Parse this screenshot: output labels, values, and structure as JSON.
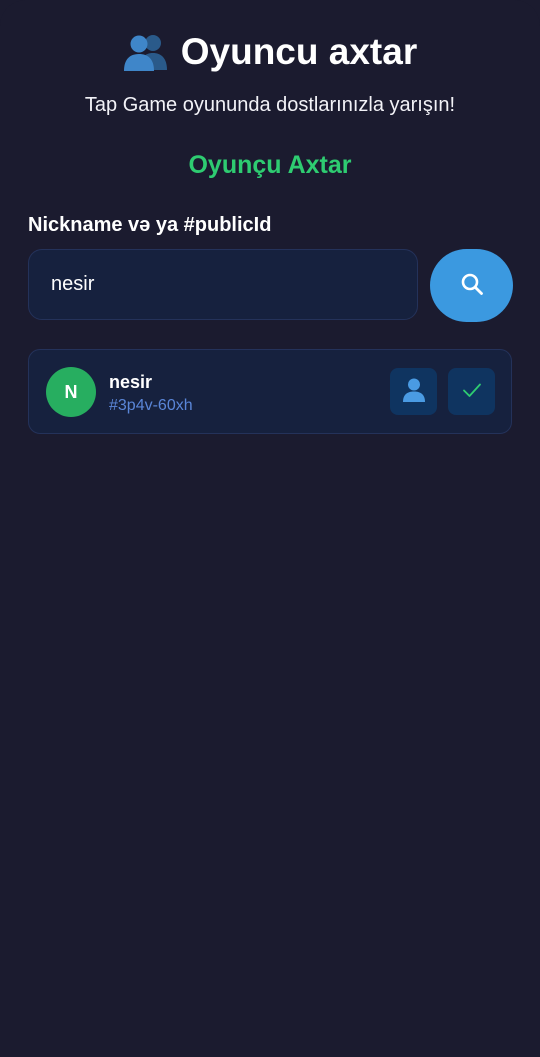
{
  "header": {
    "title": "Oyuncu axtar",
    "title_icon": "people-icon",
    "subtitle": "Tap Game oyununda dostlarınızla yarışın!"
  },
  "search_section": {
    "title": "Oyunçu Axtar",
    "field_label": "Nickname və ya #publicId",
    "input_value": "nesir",
    "search_button_icon": "search-icon"
  },
  "results": [
    {
      "avatar_letter": "N",
      "name": "nesir",
      "public_id": "#3p4v-60xh",
      "profile_icon": "person-icon",
      "status_icon": "check-icon"
    }
  ],
  "colors": {
    "background": "#1b1b2f",
    "accent_green": "#2ecc71",
    "accent_blue": "#3b99e0",
    "card_bg": "#16213e",
    "id_blue": "#5a86d8"
  }
}
